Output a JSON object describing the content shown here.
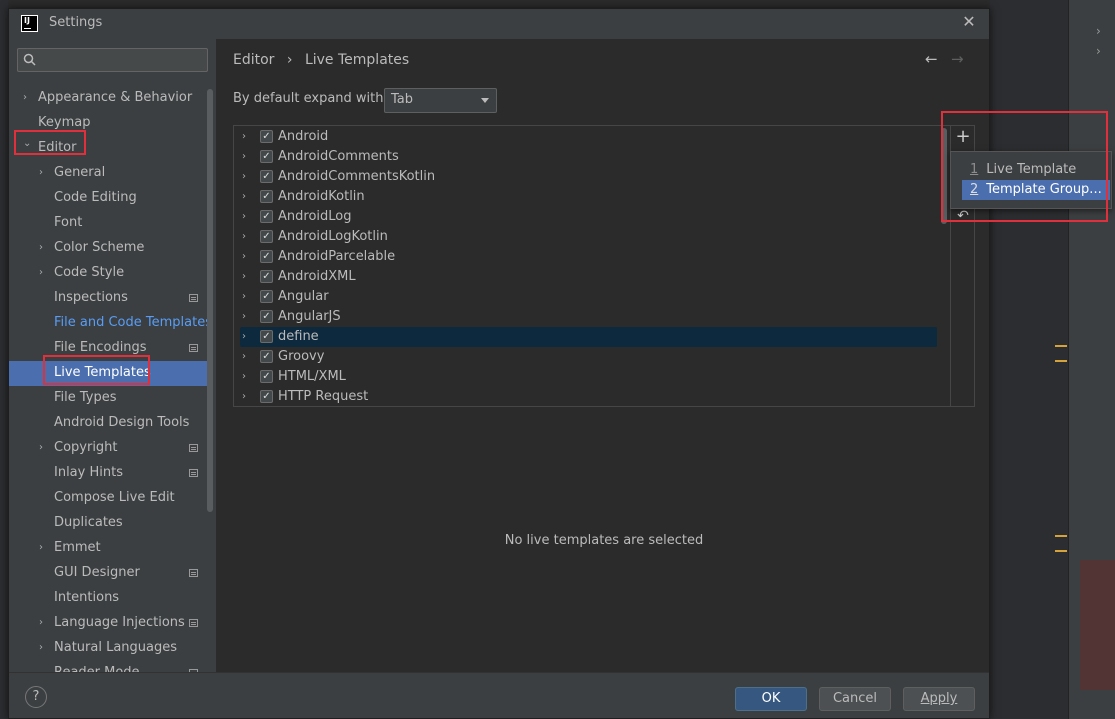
{
  "window": {
    "title": "Settings"
  },
  "search": {
    "placeholder": ""
  },
  "sidebar": {
    "items": [
      {
        "label": "Appearance & Behavior",
        "level": 0,
        "arrow": "right"
      },
      {
        "label": "Keymap",
        "level": 0,
        "arrow": ""
      },
      {
        "label": "Editor",
        "level": 0,
        "arrow": "down"
      },
      {
        "label": "General",
        "level": 1,
        "arrow": "right"
      },
      {
        "label": "Code Editing",
        "level": 1,
        "arrow": ""
      },
      {
        "label": "Font",
        "level": 1,
        "arrow": ""
      },
      {
        "label": "Color Scheme",
        "level": 1,
        "arrow": "right"
      },
      {
        "label": "Code Style",
        "level": 1,
        "arrow": "right"
      },
      {
        "label": "Inspections",
        "level": 1,
        "arrow": "",
        "badge": true
      },
      {
        "label": "File and Code Templates",
        "level": 1,
        "arrow": "",
        "link": true
      },
      {
        "label": "File Encodings",
        "level": 1,
        "arrow": "",
        "badge": true
      },
      {
        "label": "Live Templates",
        "level": 1,
        "arrow": "",
        "selected": true
      },
      {
        "label": "File Types",
        "level": 1,
        "arrow": ""
      },
      {
        "label": "Android Design Tools",
        "level": 1,
        "arrow": ""
      },
      {
        "label": "Copyright",
        "level": 1,
        "arrow": "right",
        "badge": true
      },
      {
        "label": "Inlay Hints",
        "level": 1,
        "arrow": "",
        "badge": true
      },
      {
        "label": "Compose Live Edit",
        "level": 1,
        "arrow": ""
      },
      {
        "label": "Duplicates",
        "level": 1,
        "arrow": ""
      },
      {
        "label": "Emmet",
        "level": 1,
        "arrow": "right"
      },
      {
        "label": "GUI Designer",
        "level": 1,
        "arrow": "",
        "badge": true
      },
      {
        "label": "Intentions",
        "level": 1,
        "arrow": ""
      },
      {
        "label": "Language Injections",
        "level": 1,
        "arrow": "right",
        "badge": true
      },
      {
        "label": "Natural Languages",
        "level": 1,
        "arrow": "right"
      },
      {
        "label": "Reader Mode",
        "level": 1,
        "arrow": "",
        "badge": true
      }
    ]
  },
  "breadcrumb": {
    "parent": "Editor",
    "separator": "›",
    "current": "Live Templates"
  },
  "nav": {
    "back": "←",
    "forward": "→"
  },
  "expand": {
    "label": "By default expand with",
    "value": "Tab"
  },
  "templates": [
    {
      "name": "Android",
      "checked": true
    },
    {
      "name": "AndroidComments",
      "checked": true
    },
    {
      "name": "AndroidCommentsKotlin",
      "checked": true
    },
    {
      "name": "AndroidKotlin",
      "checked": true
    },
    {
      "name": "AndroidLog",
      "checked": true
    },
    {
      "name": "AndroidLogKotlin",
      "checked": true
    },
    {
      "name": "AndroidParcelable",
      "checked": true
    },
    {
      "name": "AndroidXML",
      "checked": true
    },
    {
      "name": "Angular",
      "checked": true
    },
    {
      "name": "AngularJS",
      "checked": true
    },
    {
      "name": "define",
      "checked": true,
      "selected": true
    },
    {
      "name": "Groovy",
      "checked": true
    },
    {
      "name": "HTML/XML",
      "checked": true
    },
    {
      "name": "HTTP Request",
      "checked": true
    }
  ],
  "toolbar": {
    "add": "+",
    "undo": "↶"
  },
  "popup": {
    "items": [
      {
        "num": "1",
        "label": "Live Template"
      },
      {
        "num": "2",
        "label": "Template Group...",
        "selected": true
      }
    ]
  },
  "empty_message": "No live templates are selected",
  "footer": {
    "help": "?",
    "ok": "OK",
    "cancel": "Cancel",
    "apply": "Apply"
  },
  "colors": {
    "selection": "#4b6eaf",
    "highlight_box": "#e0303b",
    "ok_button": "#365880",
    "link": "#589df6"
  }
}
